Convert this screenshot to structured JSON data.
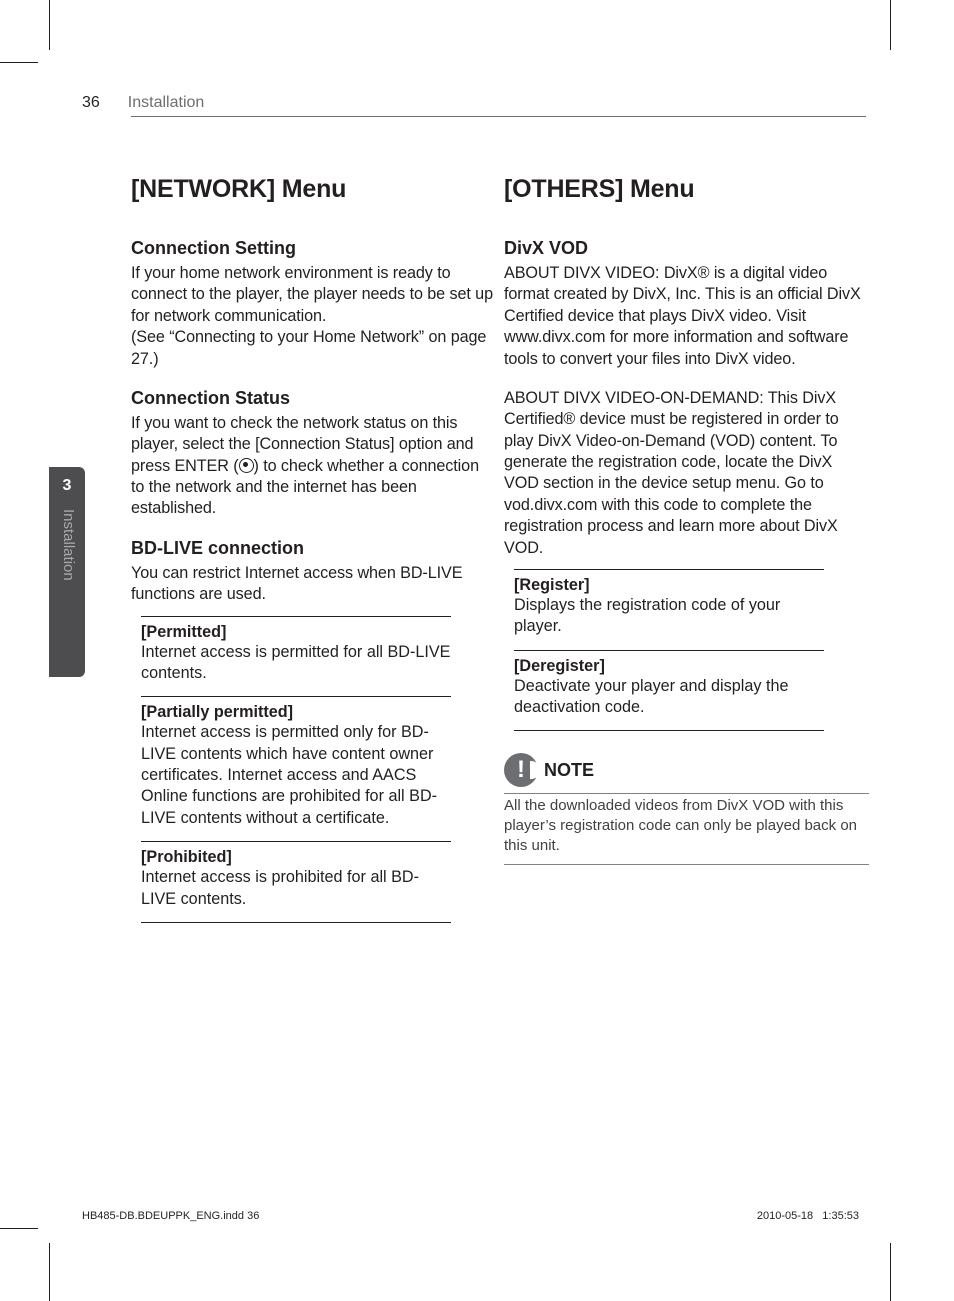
{
  "header": {
    "page_number": "36",
    "section": "Installation"
  },
  "sidetab": {
    "number": "3",
    "label": "Installation"
  },
  "left": {
    "title": "[NETWORK] Menu",
    "sections": {
      "conn_set": {
        "h": "Connection Setting",
        "p": "If your home network environment is ready to connect to the player, the player needs to be set up for network communication.\n(See “Connecting to your Home Network” on page 27.)"
      },
      "conn_stat": {
        "h": "Connection Status",
        "p_before": "If you want to check the network status on this player, select the [Connection Status] option and press ENTER (",
        "p_after": ") to check whether a connection to the network and the internet has been established."
      },
      "bd_live": {
        "h": "BD-LIVE connection",
        "p": "You can restrict Internet access when BD-LIVE functions are used.",
        "options": [
          {
            "t": "[Permitted]",
            "b": "Internet access is permitted for all BD-LIVE contents."
          },
          {
            "t": "[Partially permitted]",
            "b": "Internet access is permitted only for BD-LIVE contents which have content owner certificates. Internet access and AACS Online functions are prohibited for all BD-LIVE contents without a certificate."
          },
          {
            "t": "[Prohibited]",
            "b": "Internet access is prohibited for all BD-LIVE contents."
          }
        ]
      }
    }
  },
  "right": {
    "title": "[OTHERS] Menu",
    "divx": {
      "h": "DivX VOD",
      "p1": "ABOUT DIVX VIDEO: DivX® is a digital video format created by DivX, Inc. This is an official DivX Certified device that plays DivX video. Visit www.divx.com for more information and software tools to convert your files into DivX video.",
      "p2": "ABOUT DIVX VIDEO-ON-DEMAND: This DivX Certified® device must be registered in order to play DivX Video-on-Demand (VOD) content. To generate the registration code, locate the DivX VOD section in the device setup menu. Go to vod.divx.com with this code to complete the registration process and learn more about DivX VOD.",
      "options": [
        {
          "t": "[Register]",
          "b": "Displays the registration code of your player."
        },
        {
          "t": "[Deregister]",
          "b": "Deactivate your player and display the deactivation code."
        }
      ]
    },
    "note": {
      "label": "NOTE",
      "body": "All the downloaded videos from DivX VOD with this player’s registration code can only be played back on this unit."
    }
  },
  "footer": {
    "file": "HB485-DB.BDEUPPK_ENG.indd   36",
    "date": "2010-05-18",
    "time": "1:35:53"
  }
}
